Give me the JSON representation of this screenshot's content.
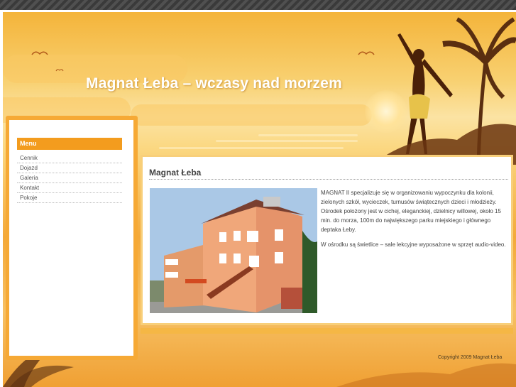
{
  "site": {
    "title": "Magnat Łeba – wczasy nad morzem"
  },
  "sidebar": {
    "menu_title": "Menu",
    "items": [
      {
        "label": "Cennik"
      },
      {
        "label": "Dojazd"
      },
      {
        "label": "Galeria"
      },
      {
        "label": "Kontakt"
      },
      {
        "label": "Pokoje"
      }
    ]
  },
  "main": {
    "heading": "Magnat Łeba",
    "paragraphs": [
      "MAGNAT II specjalizuje się w organizowaniu wypoczynku dla kolonii, zielonych szkół, wycieczek, turnusów świątecznych dzieci i młodzieży. Ośrodek położony jest w cichej, eleganckiej, dzielnicy willowej, około 15 min. do morza, 100m do największego parku miejskiego i głównego deptaka Łeby.",
      "W ośrodku są świetlice – sale lekcyjne wyposażone w sprzęt audio-video."
    ]
  },
  "footer": {
    "copyright": "Copyright 2009 Magnat Łeba"
  },
  "colors": {
    "accent": "#f39c1e",
    "sidebar_border": "#f6a935",
    "title_text": "#ffffff"
  }
}
